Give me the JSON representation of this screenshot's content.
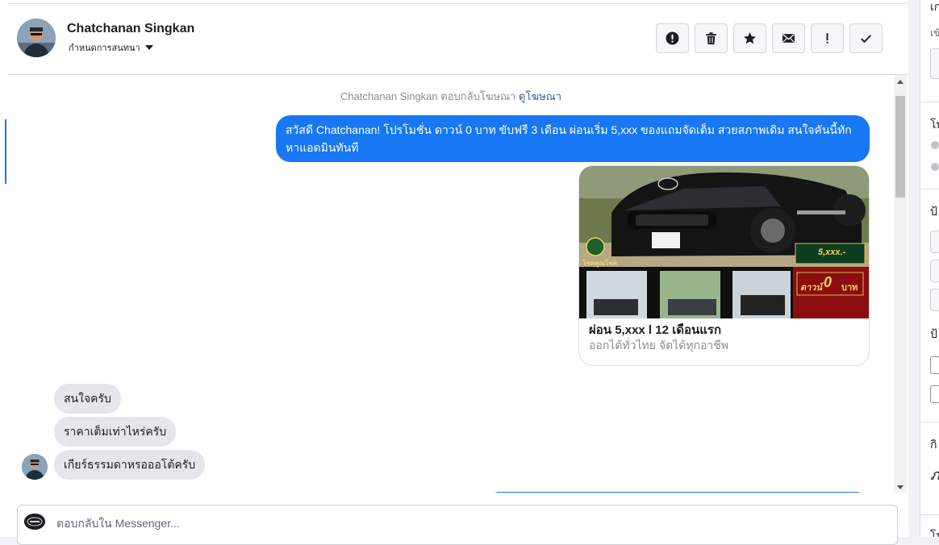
{
  "header": {
    "contact_name": "Chatchanan Singkan",
    "subtitle": "กำหนดการสนทนา",
    "toolbar": [
      {
        "name": "report-button",
        "icon": "alert-circle-icon"
      },
      {
        "name": "delete-button",
        "icon": "trash-icon"
      },
      {
        "name": "star-button",
        "icon": "star-icon"
      },
      {
        "name": "mark-unread-button",
        "icon": "envelope-icon"
      },
      {
        "name": "spam-button",
        "icon": "exclamation-icon"
      },
      {
        "name": "done-button",
        "icon": "check-icon"
      }
    ]
  },
  "thread": {
    "notice": {
      "text": "Chatchanan Singkan ตอบกลับโฆษณา",
      "link": "ดูโฆษณา"
    },
    "outgoing_message": "สวัสดี Chatchanan! โปรโมชั่น ดาวน์ 0 บาท ขับฟรี 3 เดือน ผ่อนเริ่ม 5,xxx ของแถมจัดเต็ม สวยสภาพเดิม สนใจคันนี้ทักหาแอดมินทันที",
    "ad": {
      "title": "ผ่อน 5,xxx l 12 เดือนแรก",
      "subtitle": "ออกได้ทั่วไทย จัดได้ทุกอาชีพ",
      "image_price_tag": "5,xxx.-",
      "image_down_text": "ดาวน์",
      "image_down_zero": "0",
      "image_down_unit": "บาท",
      "image_logo_text": "โชคคูณโชค"
    },
    "incoming_messages": [
      "สนใจครับ",
      "ราคาเต็มเท่าไหร่ครับ",
      "เกียร์ธรรมดาหรอออโต้ครับ"
    ]
  },
  "composer": {
    "placeholder": "ตอบกลับใน Messenger..."
  },
  "right_panel": {
    "labels": [
      "เก",
      "เข้",
      "โท",
      "ป้",
      "ป้",
      "กิ",
      "ภ",
      "โน"
    ]
  },
  "colors": {
    "accent": "#1877f2",
    "incoming_bubble": "#e4e6eb",
    "muted_text": "#8a8d91",
    "link": "#385898"
  }
}
